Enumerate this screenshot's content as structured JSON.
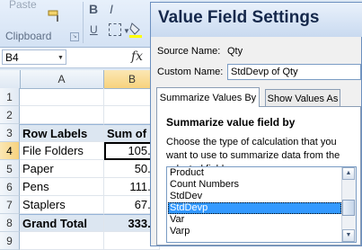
{
  "ribbon": {
    "paste_label": "Paste",
    "group_label": "Clipboard",
    "bold_label": "B",
    "italic_label": "I",
    "underline_label": "U"
  },
  "formula_bar": {
    "name_box": "B4",
    "fx_label": "fx"
  },
  "sheet": {
    "columns": [
      "A",
      "B"
    ],
    "rows": [
      {
        "num": "1",
        "a": "",
        "b": ""
      },
      {
        "num": "2",
        "a": "",
        "b": ""
      },
      {
        "num": "3",
        "a": "Row Labels",
        "b": "Sum of"
      },
      {
        "num": "4",
        "a": "File Folders",
        "b": "105.0"
      },
      {
        "num": "5",
        "a": "Paper",
        "b": "50.0"
      },
      {
        "num": "6",
        "a": "Pens",
        "b": "111.0"
      },
      {
        "num": "7",
        "a": "Staplers",
        "b": "67.0"
      },
      {
        "num": "8",
        "a": "Grand Total",
        "b": "333.0"
      },
      {
        "num": "9",
        "a": "",
        "b": ""
      }
    ]
  },
  "dialog": {
    "title": "Value Field Settings",
    "source_label": "Source Name:",
    "source_value": "Qty",
    "custom_label": "Custom Name:",
    "custom_value": "StdDevp of Qty",
    "tabs": [
      "Summarize Values By",
      "Show Values As"
    ],
    "summarize_heading": "Summarize value field by",
    "summarize_desc": "Choose the type of calculation that you want to use to summarize data from the selected field",
    "functions": [
      "Product",
      "Count Numbers",
      "StdDev",
      "StdDevp",
      "Var",
      "Varp"
    ],
    "selected_function": "StdDevp"
  },
  "colors": {
    "title_text": "#15284b",
    "selection": "#3399ff",
    "header_highlight": "#f7d27d",
    "pivot_header": "#dce6f1"
  }
}
